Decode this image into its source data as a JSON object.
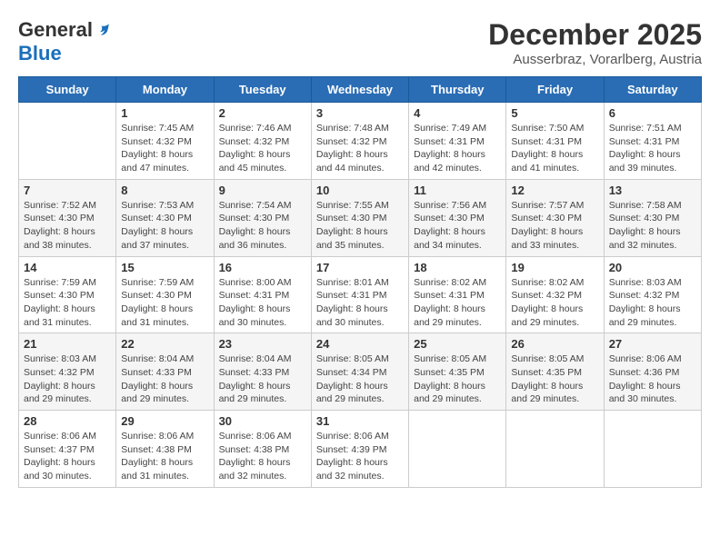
{
  "header": {
    "logo_line1": "General",
    "logo_line2": "Blue",
    "month": "December 2025",
    "location": "Ausserbraz, Vorarlberg, Austria"
  },
  "weekdays": [
    "Sunday",
    "Monday",
    "Tuesday",
    "Wednesday",
    "Thursday",
    "Friday",
    "Saturday"
  ],
  "weeks": [
    [
      {
        "day": "",
        "info": ""
      },
      {
        "day": "1",
        "info": "Sunrise: 7:45 AM\nSunset: 4:32 PM\nDaylight: 8 hours\nand 47 minutes."
      },
      {
        "day": "2",
        "info": "Sunrise: 7:46 AM\nSunset: 4:32 PM\nDaylight: 8 hours\nand 45 minutes."
      },
      {
        "day": "3",
        "info": "Sunrise: 7:48 AM\nSunset: 4:32 PM\nDaylight: 8 hours\nand 44 minutes."
      },
      {
        "day": "4",
        "info": "Sunrise: 7:49 AM\nSunset: 4:31 PM\nDaylight: 8 hours\nand 42 minutes."
      },
      {
        "day": "5",
        "info": "Sunrise: 7:50 AM\nSunset: 4:31 PM\nDaylight: 8 hours\nand 41 minutes."
      },
      {
        "day": "6",
        "info": "Sunrise: 7:51 AM\nSunset: 4:31 PM\nDaylight: 8 hours\nand 39 minutes."
      }
    ],
    [
      {
        "day": "7",
        "info": "Sunrise: 7:52 AM\nSunset: 4:30 PM\nDaylight: 8 hours\nand 38 minutes."
      },
      {
        "day": "8",
        "info": "Sunrise: 7:53 AM\nSunset: 4:30 PM\nDaylight: 8 hours\nand 37 minutes."
      },
      {
        "day": "9",
        "info": "Sunrise: 7:54 AM\nSunset: 4:30 PM\nDaylight: 8 hours\nand 36 minutes."
      },
      {
        "day": "10",
        "info": "Sunrise: 7:55 AM\nSunset: 4:30 PM\nDaylight: 8 hours\nand 35 minutes."
      },
      {
        "day": "11",
        "info": "Sunrise: 7:56 AM\nSunset: 4:30 PM\nDaylight: 8 hours\nand 34 minutes."
      },
      {
        "day": "12",
        "info": "Sunrise: 7:57 AM\nSunset: 4:30 PM\nDaylight: 8 hours\nand 33 minutes."
      },
      {
        "day": "13",
        "info": "Sunrise: 7:58 AM\nSunset: 4:30 PM\nDaylight: 8 hours\nand 32 minutes."
      }
    ],
    [
      {
        "day": "14",
        "info": "Sunrise: 7:59 AM\nSunset: 4:30 PM\nDaylight: 8 hours\nand 31 minutes."
      },
      {
        "day": "15",
        "info": "Sunrise: 7:59 AM\nSunset: 4:30 PM\nDaylight: 8 hours\nand 31 minutes."
      },
      {
        "day": "16",
        "info": "Sunrise: 8:00 AM\nSunset: 4:31 PM\nDaylight: 8 hours\nand 30 minutes."
      },
      {
        "day": "17",
        "info": "Sunrise: 8:01 AM\nSunset: 4:31 PM\nDaylight: 8 hours\nand 30 minutes."
      },
      {
        "day": "18",
        "info": "Sunrise: 8:02 AM\nSunset: 4:31 PM\nDaylight: 8 hours\nand 29 minutes."
      },
      {
        "day": "19",
        "info": "Sunrise: 8:02 AM\nSunset: 4:32 PM\nDaylight: 8 hours\nand 29 minutes."
      },
      {
        "day": "20",
        "info": "Sunrise: 8:03 AM\nSunset: 4:32 PM\nDaylight: 8 hours\nand 29 minutes."
      }
    ],
    [
      {
        "day": "21",
        "info": "Sunrise: 8:03 AM\nSunset: 4:32 PM\nDaylight: 8 hours\nand 29 minutes."
      },
      {
        "day": "22",
        "info": "Sunrise: 8:04 AM\nSunset: 4:33 PM\nDaylight: 8 hours\nand 29 minutes."
      },
      {
        "day": "23",
        "info": "Sunrise: 8:04 AM\nSunset: 4:33 PM\nDaylight: 8 hours\nand 29 minutes."
      },
      {
        "day": "24",
        "info": "Sunrise: 8:05 AM\nSunset: 4:34 PM\nDaylight: 8 hours\nand 29 minutes."
      },
      {
        "day": "25",
        "info": "Sunrise: 8:05 AM\nSunset: 4:35 PM\nDaylight: 8 hours\nand 29 minutes."
      },
      {
        "day": "26",
        "info": "Sunrise: 8:05 AM\nSunset: 4:35 PM\nDaylight: 8 hours\nand 29 minutes."
      },
      {
        "day": "27",
        "info": "Sunrise: 8:06 AM\nSunset: 4:36 PM\nDaylight: 8 hours\nand 30 minutes."
      }
    ],
    [
      {
        "day": "28",
        "info": "Sunrise: 8:06 AM\nSunset: 4:37 PM\nDaylight: 8 hours\nand 30 minutes."
      },
      {
        "day": "29",
        "info": "Sunrise: 8:06 AM\nSunset: 4:38 PM\nDaylight: 8 hours\nand 31 minutes."
      },
      {
        "day": "30",
        "info": "Sunrise: 8:06 AM\nSunset: 4:38 PM\nDaylight: 8 hours\nand 32 minutes."
      },
      {
        "day": "31",
        "info": "Sunrise: 8:06 AM\nSunset: 4:39 PM\nDaylight: 8 hours\nand 32 minutes."
      },
      {
        "day": "",
        "info": ""
      },
      {
        "day": "",
        "info": ""
      },
      {
        "day": "",
        "info": ""
      }
    ]
  ]
}
